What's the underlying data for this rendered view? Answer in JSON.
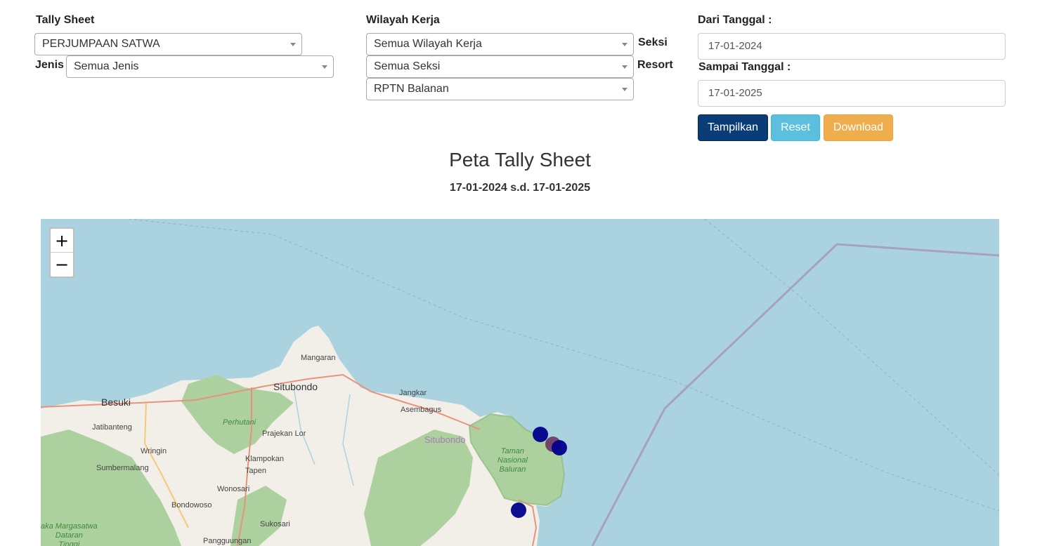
{
  "filters": {
    "tally_sheet": {
      "label": "Tally Sheet",
      "value": "PERJUMPAAN SATWA"
    },
    "jenis": {
      "label": "Jenis",
      "value": "Semua Jenis"
    },
    "wilayah_kerja": {
      "label": "Wilayah Kerja",
      "value": "Semua Wilayah Kerja"
    },
    "seksi": {
      "label": "Seksi",
      "value": "Semua Seksi"
    },
    "resort": {
      "label": "Resort",
      "value": "RPTN Balanan"
    },
    "dari_tanggal": {
      "label": "Dari Tanggal :",
      "value": "17-01-2024"
    },
    "sampai_tanggal": {
      "label": "Sampai Tanggal :",
      "value": "17-01-2025"
    }
  },
  "buttons": {
    "tampilkan": {
      "label": "Tampilkan",
      "color": "#0a3c78"
    },
    "reset": {
      "label": "Reset",
      "color": "#5bc0de"
    },
    "download": {
      "label": "Download",
      "color": "#f0ad4e"
    }
  },
  "map_header": {
    "title": "Peta Tally Sheet",
    "subtitle": "17-01-2024 s.d. 17-01-2025"
  },
  "map": {
    "zoom_in": "+",
    "zoom_out": "−",
    "colors": {
      "sea": "#aad3df",
      "land": "#f2efe9",
      "forest": "#add19e",
      "marker": "#00008b",
      "marker_alt": "#6b2a5c"
    },
    "places": {
      "mangaran": "Mangaran",
      "situbondo": "Situbondo",
      "besuki": "Besuki",
      "jangkar": "Jangkar",
      "asembagus": "Asembagus",
      "jatibanteng": "Jatibanteng",
      "perhutani": "Perhutani",
      "prajekan_lor": "Prajekan Lor",
      "situbondo_region": "Situbondo",
      "wringin": "Wringin",
      "klampokan": "Klampokan",
      "tapen": "Tapen",
      "sumbermalang": "Sumbermalang",
      "wonosari": "Wonosari",
      "bondowoso": "Bondowoso",
      "sukosari": "Sukosari",
      "pangguingan": "Pangguungan",
      "taman_nasional_baluran": [
        "Taman",
        "Nasional",
        "Baluran"
      ],
      "suaka_margasatwa": [
        "aka Margasatwa",
        "Dataran",
        "Tinggi"
      ]
    }
  }
}
